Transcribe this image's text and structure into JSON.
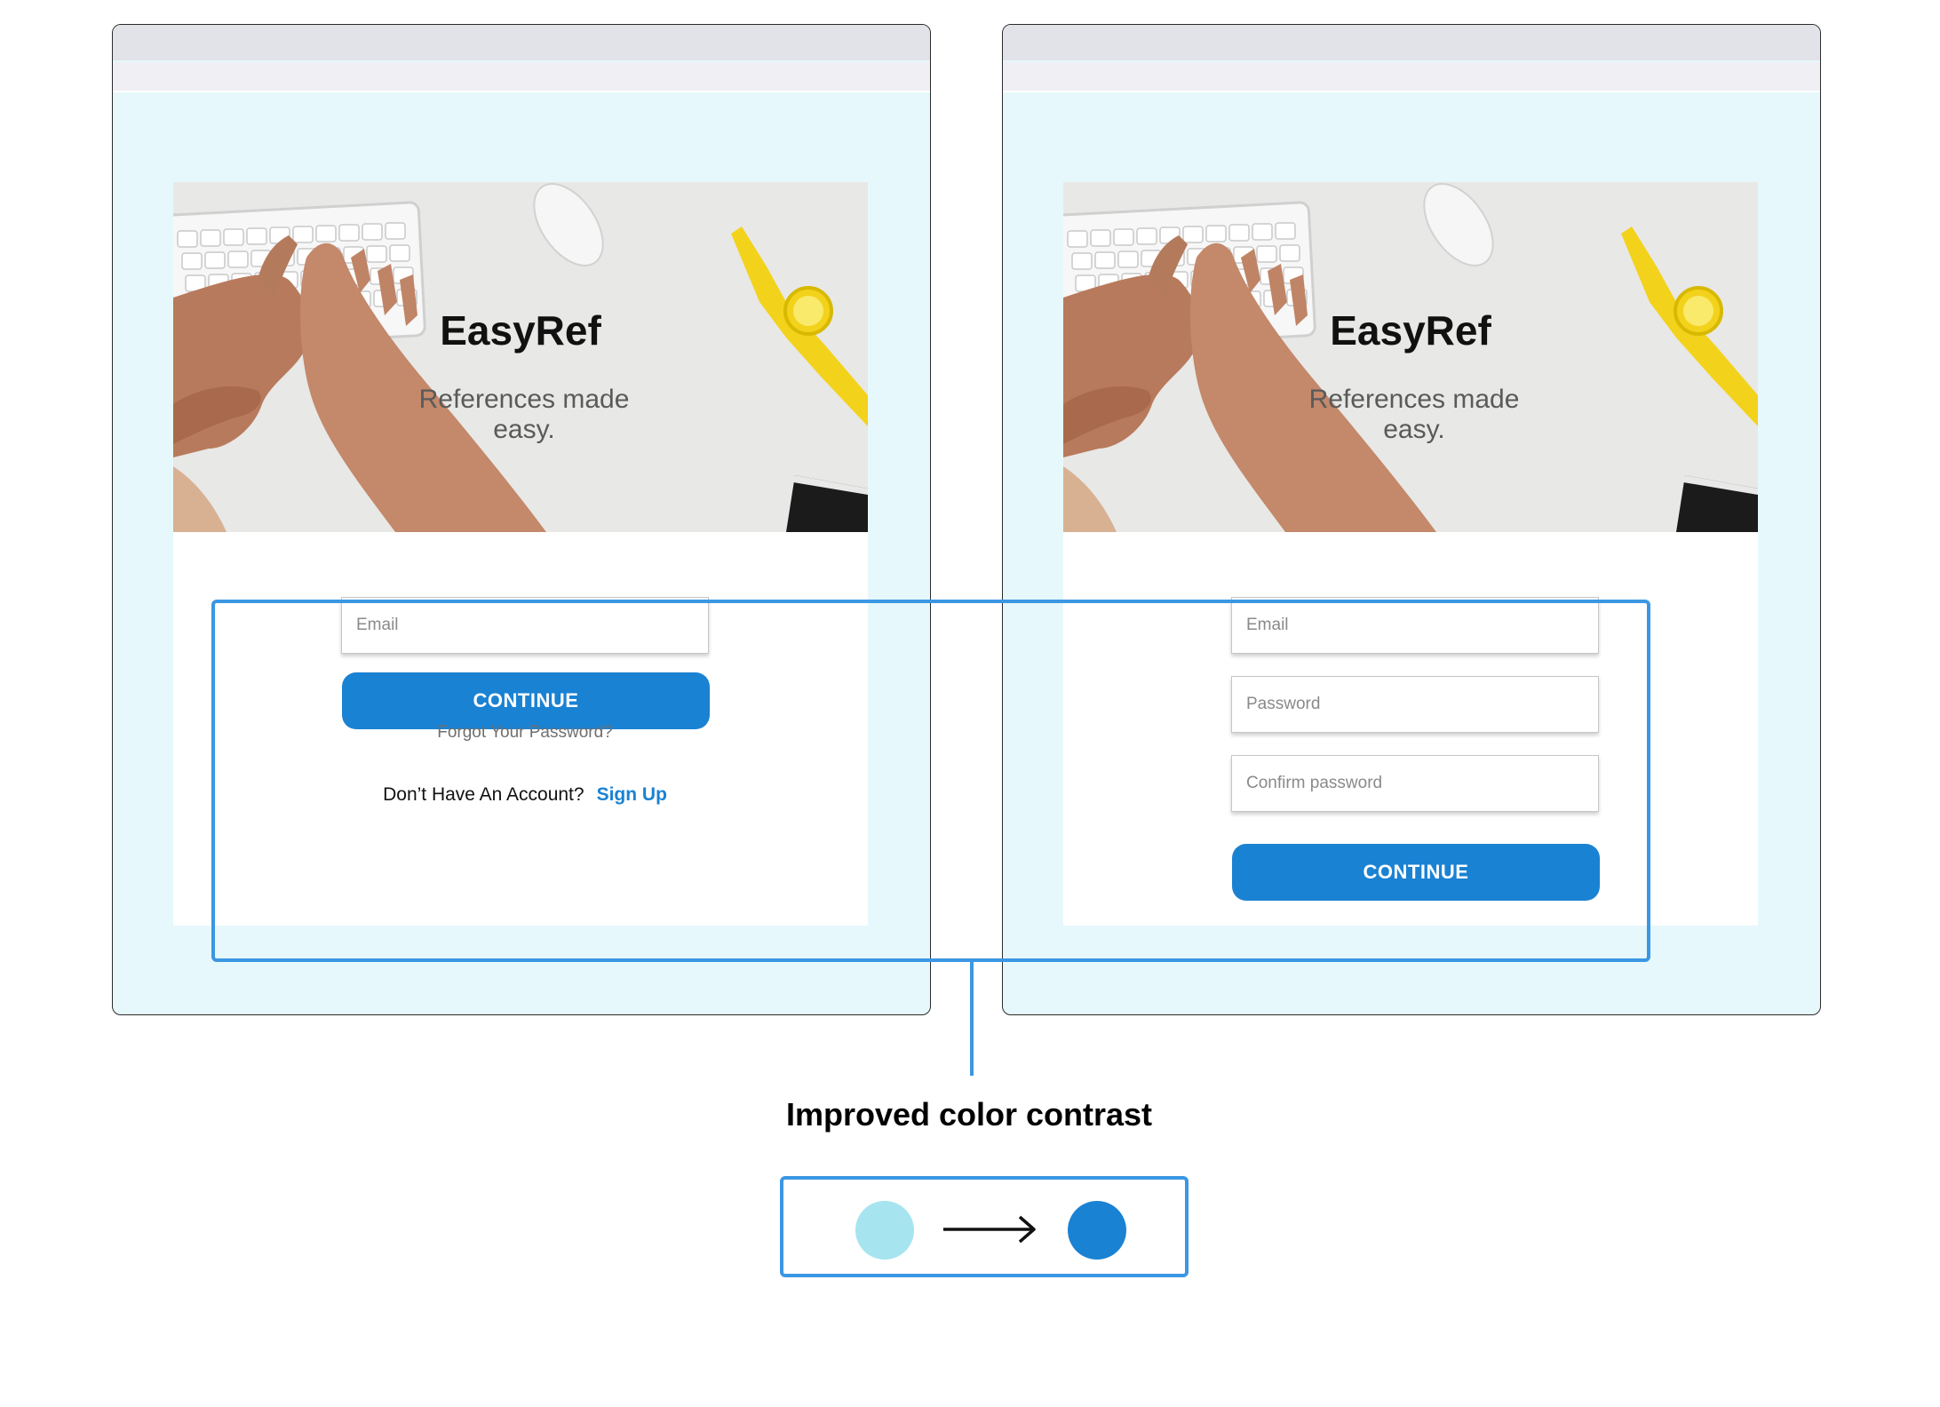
{
  "screens": {
    "left": {
      "brand": {
        "title": "EasyRef",
        "subtitle": "References made easy."
      },
      "email_placeholder": "Email",
      "continue_label": "CONTINUE",
      "forgot_password": "Forgot Your Password?",
      "no_account": "Don’t Have An Account?",
      "sign_up": "Sign Up"
    },
    "right": {
      "brand": {
        "title": "EasyRef",
        "subtitle": "References made easy."
      },
      "email_placeholder": "Email",
      "password_placeholder": "Password",
      "confirm_password_placeholder": "Confirm password",
      "continue_label": "CONTINUE"
    }
  },
  "annotation": {
    "caption": "Improved color contrast",
    "before_color": "#a6e4f0",
    "after_color": "#1a82d3",
    "highlight_color": "#3b97e3"
  },
  "colors": {
    "page_background": "#e6f8fb",
    "button": "#1a82d3",
    "link": "#1a82d3"
  }
}
